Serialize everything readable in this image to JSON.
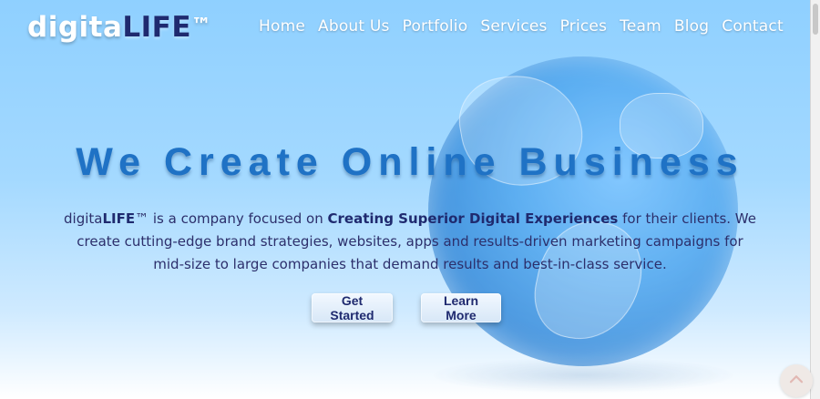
{
  "brand": {
    "logo_prefix": "digita",
    "logo_life": "LIFE",
    "logo_tm": "™"
  },
  "nav": {
    "items": [
      "Home",
      "About Us",
      "Portfolio",
      "Services",
      "Prices",
      "Team",
      "Blog",
      "Contact"
    ]
  },
  "hero": {
    "title": "We Create Online Business",
    "text": {
      "part1": "digita",
      "part2": "LIFE",
      "part3": "™ is a company focused on ",
      "part4": "Creating Superior Digital Experiences",
      "part5": " for their clients. We create cutting-edge brand strategies, websites, apps and results-driven marketing campaigns for mid-size to large companies that demand results and best-in-class service."
    },
    "buttons": {
      "get_started": "Get Started",
      "learn_more": "Learn More"
    }
  },
  "icons": {
    "back_to_top": "chevron-up-icon"
  },
  "colors": {
    "background_top": "#8fd0ff",
    "title": "#1f72c5",
    "brand_dark": "#1f2a6f",
    "text": "#2c2f6b",
    "white": "#ffffff"
  }
}
